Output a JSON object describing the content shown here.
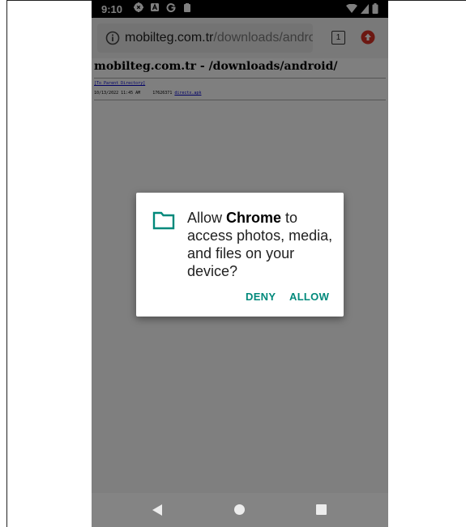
{
  "status_bar": {
    "time": "9:10",
    "icons": [
      "settings-icon",
      "notification-a-icon",
      "google-icon",
      "clipboard-icon"
    ],
    "right_icons": [
      "wifi-icon",
      "signal-icon",
      "battery-icon"
    ]
  },
  "browser": {
    "url_host": "mobilteg.com.tr",
    "url_path": "/downloads/android",
    "tab_count": "1",
    "colors": {
      "update_badge": "#d93025"
    }
  },
  "page": {
    "title": "mobilteg.com.tr - /downloads/android/",
    "parent_link": "[To Parent Directory]",
    "file_meta": "10/13/2022 11:45 AM     17626371 ",
    "file_name": "directx.apk"
  },
  "dialog": {
    "prefix": "Allow ",
    "app": "Chrome",
    "suffix": " to access photos, media, and files on your device?",
    "deny_label": "DENY",
    "allow_label": "ALLOW",
    "colors": {
      "accent": "#00897b"
    }
  },
  "nav": {
    "icons": [
      "back-icon",
      "home-icon",
      "recents-icon"
    ]
  }
}
